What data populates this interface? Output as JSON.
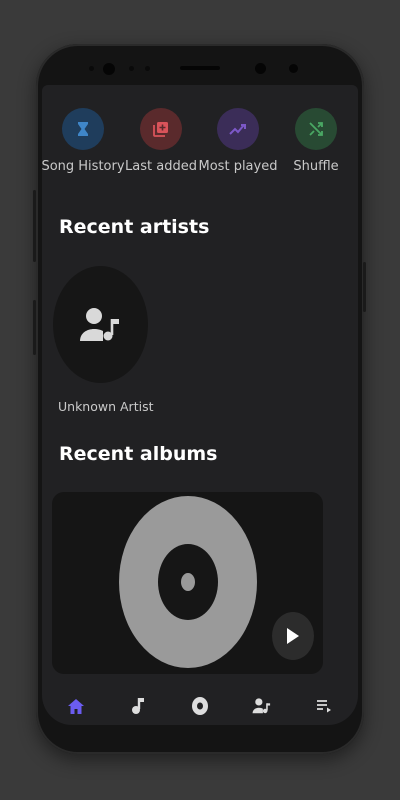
{
  "quick_actions": [
    {
      "label": "Song History",
      "icon": "hourglass-icon",
      "bg": "#1f3d5c",
      "fg": "#3f86c8"
    },
    {
      "label": "Last added",
      "icon": "library-add-icon",
      "bg": "#5a2a2c",
      "fg": "#d9535a"
    },
    {
      "label": "Most played",
      "icon": "trending-icon",
      "bg": "#3b2d58",
      "fg": "#7c58c8"
    },
    {
      "label": "Shuffle",
      "icon": "shuffle-icon",
      "bg": "#284a33",
      "fg": "#4aa864"
    }
  ],
  "sections": {
    "recent_artists": "Recent artists",
    "recent_albums": "Recent albums"
  },
  "artists": [
    {
      "name": "Unknown Artist",
      "icon": "artist-icon"
    }
  ],
  "nav": [
    {
      "name": "home",
      "icon": "home-icon",
      "active": true
    },
    {
      "name": "songs",
      "icon": "music-note-icon",
      "active": false
    },
    {
      "name": "albums",
      "icon": "album-icon",
      "active": false
    },
    {
      "name": "artists",
      "icon": "artist-icon",
      "active": false
    },
    {
      "name": "playlists",
      "icon": "playlist-icon",
      "active": false
    }
  ],
  "colors": {
    "accent": "#6b5cf0",
    "background": "#212123",
    "text": "#ffffff",
    "muted": "#c9c9c9"
  }
}
